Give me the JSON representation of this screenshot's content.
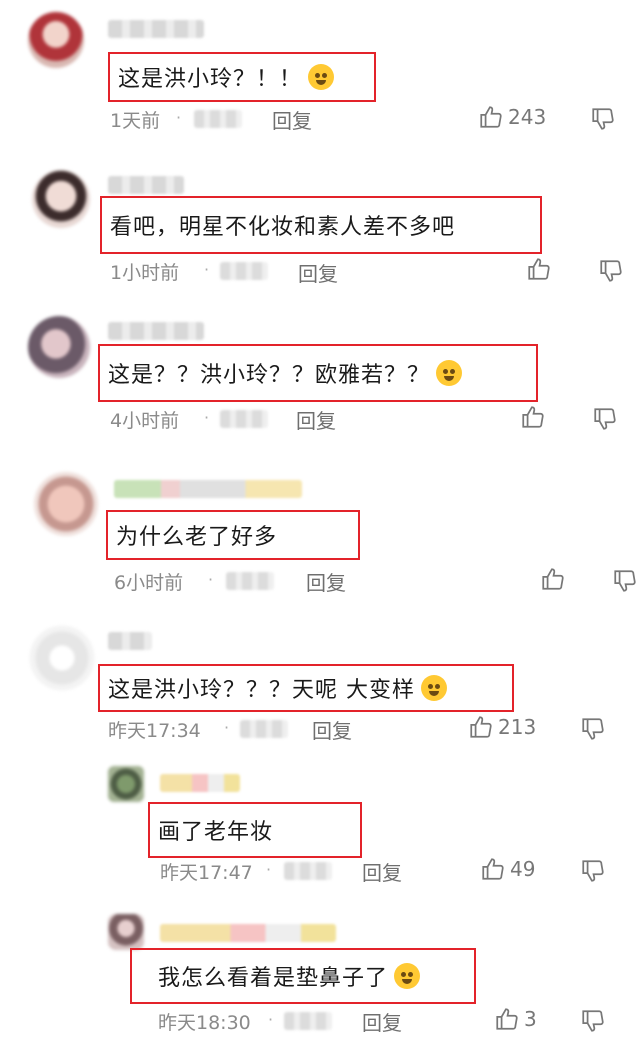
{
  "comments": [
    {
      "text": "这是洪小玲？！！",
      "emoji": "crying-face",
      "time": "1天前",
      "reply": "回复",
      "likes": "243"
    },
    {
      "text": "看吧，明星不化妆和素人差不多吧",
      "time": "1小时前",
      "reply": "回复",
      "likes": ""
    },
    {
      "text": "这是？？洪小玲？？欧雅若？？",
      "emoji": "pleading-face",
      "time": "4小时前",
      "reply": "回复",
      "likes": ""
    },
    {
      "text": "为什么老了好多",
      "time": "6小时前",
      "reply": "回复",
      "likes": ""
    },
    {
      "text": "这是洪小玲？？？天呢 大变样",
      "emoji": "rolling-laughing-face",
      "time": "昨天17:34",
      "reply": "回复",
      "likes": "213"
    },
    {
      "text": "画了老年妆",
      "time": "昨天17:47",
      "reply": "回复",
      "likes": "49"
    },
    {
      "text": "我怎么看着是垫鼻子了",
      "emoji": "rolling-laughing-face",
      "time": "昨天18:30",
      "reply": "回复",
      "likes": "3"
    }
  ],
  "icons": {
    "like": "thumbs-up-icon",
    "dislike": "thumbs-down-icon"
  },
  "colors": {
    "highlight_box": "#e3232a",
    "meta_text": "#8a8a8a"
  }
}
